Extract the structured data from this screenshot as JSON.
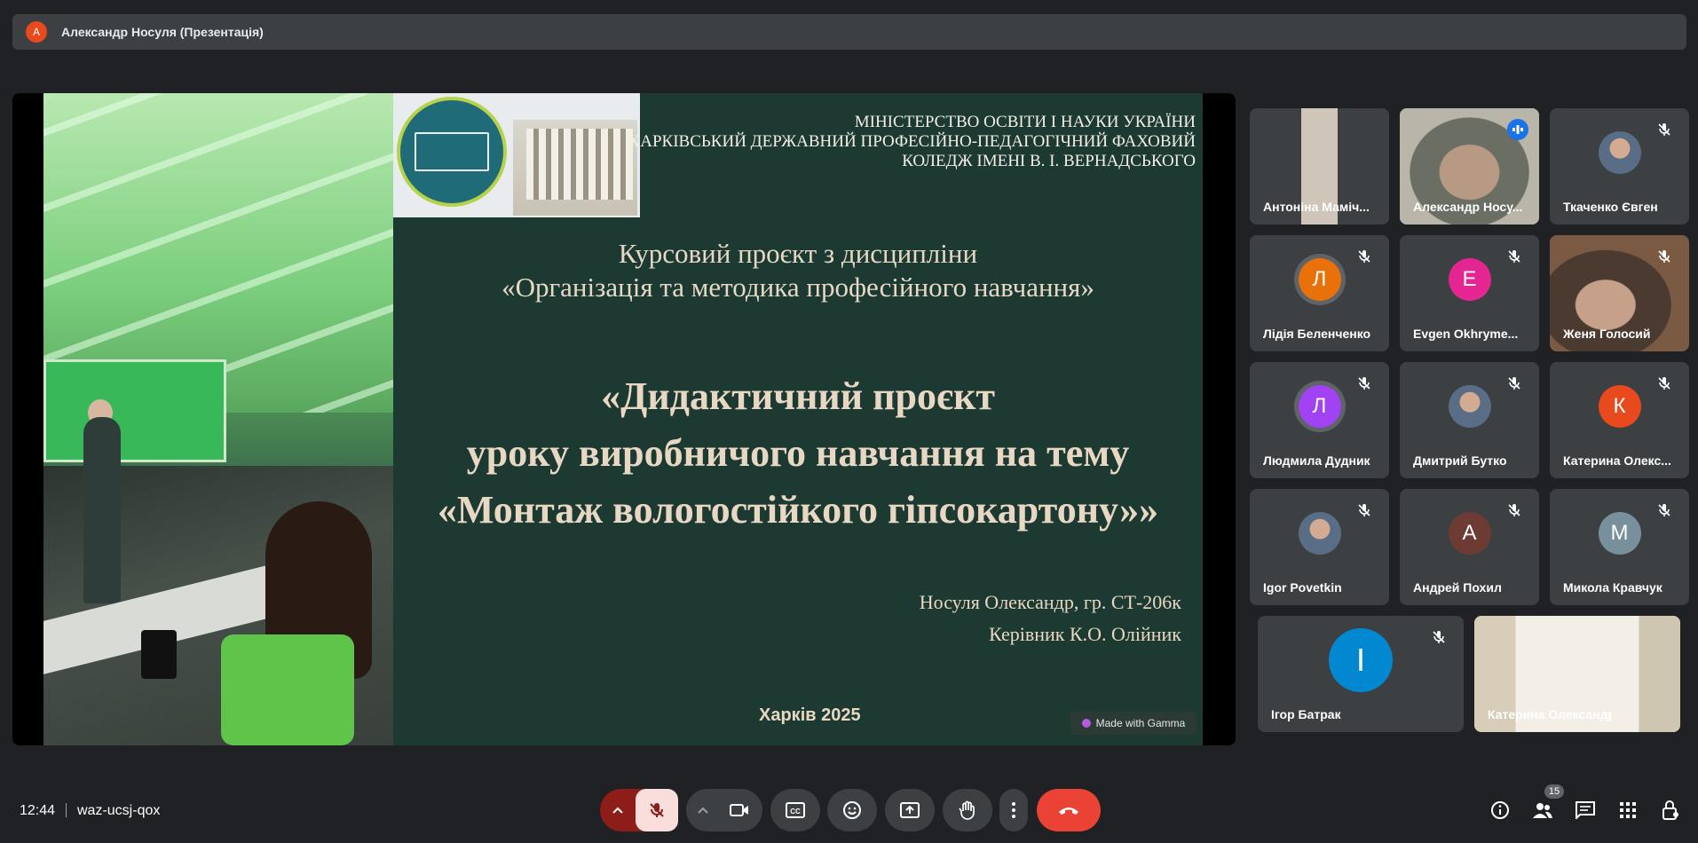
{
  "presenter_bar": {
    "avatar_letter": "А",
    "label": "Александр Носуля (Презентація)"
  },
  "slide": {
    "ministry_lines": [
      "МІНІСТЕРСТВО ОСВІТИ І НАУКИ УКРАЇНИ",
      "ХАРКІВСЬКИЙ ДЕРЖАВНИЙ ПРОФЕСІЙНО-ПЕДАГОГІЧНИЙ ФАХОВИЙ",
      "КОЛЕДЖ ІМЕНІ В. І. ВЕРНАДСЬКОГО"
    ],
    "course_lines": [
      "Курсовий проєкт з дисципліни",
      "«Організація та методика професійного навчання»"
    ],
    "topic_lines": [
      "«Дидактичний проєкт",
      "уроку виробничого навчання на тему",
      "«Монтаж вологостійкого гіпсокартону»»"
    ],
    "author": "Носуля Олександр, гр. СТ-206к",
    "supervisor": "Керівник  К.О. Олійник",
    "city_year": "Харків 2025",
    "gamma_badge": "Made with Gamma"
  },
  "participants": [
    {
      "name": "Антоніна Маміч...",
      "type": "video",
      "muted": false
    },
    {
      "name": "Александр Носу...",
      "type": "video",
      "muted": false,
      "speaking": true
    },
    {
      "name": "Ткаченко Євген",
      "type": "photo",
      "muted": true
    },
    {
      "name": "Лідія Беленченко",
      "type": "letter",
      "letter": "Л",
      "color": "#e8710a",
      "muted": true
    },
    {
      "name": "Evgen Okhryme...",
      "type": "letter",
      "letter": "E",
      "color": "#e52592",
      "muted": true
    },
    {
      "name": "Женя Голосий",
      "type": "video",
      "muted": true
    },
    {
      "name": "Людмила Дудник",
      "type": "letter",
      "letter": "Л",
      "color": "#a142f4",
      "muted": true
    },
    {
      "name": "Дмитрий Бутко",
      "type": "photo",
      "muted": true
    },
    {
      "name": "Катерина Олекс...",
      "type": "letter",
      "letter": "К",
      "color": "#e8491d",
      "muted": true
    },
    {
      "name": "Igor Povetkin",
      "type": "photo",
      "muted": true
    },
    {
      "name": "Андрей Похил",
      "type": "letter",
      "letter": "А",
      "color": "#6d3b33",
      "muted": true
    },
    {
      "name": "Микола Кравчук",
      "type": "letter",
      "letter": "М",
      "color": "#78909c",
      "muted": true
    },
    {
      "name": "Ігор Батрак",
      "type": "letter",
      "letter": "І",
      "color": "#0288d1",
      "muted": true
    },
    {
      "name": "Катерина Олександрівна ...",
      "type": "video",
      "muted": false
    }
  ],
  "bottom_bar": {
    "time": "12:44",
    "meeting_code": "waz-ucsj-qox",
    "participants_count": "15",
    "colors": {
      "mic_off": "#f9dedc",
      "end_call": "#ea4335",
      "mic_group": "#8c1d18"
    }
  }
}
